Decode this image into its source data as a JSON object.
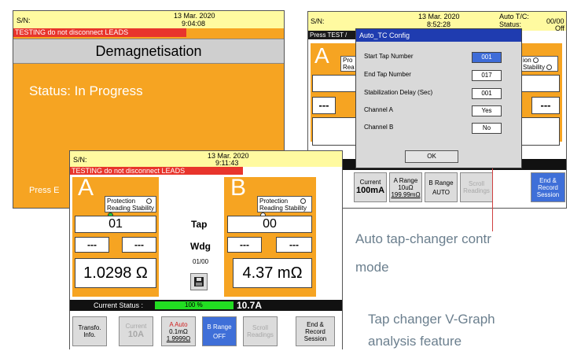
{
  "left_screen": {
    "sn_label": "S/N:",
    "date": "13 Mar. 2020",
    "time": "9:04:08",
    "warning": "TESTING do not disconnect LEADS",
    "title": "Demagnetisation",
    "status": "Status: In Progress",
    "footer_prefix": "Press E"
  },
  "right_screen": {
    "sn_label": "S/N:",
    "date": "13 Mar. 2020",
    "time": "8:52:28",
    "auto_tc_label": "Auto T/C:",
    "status_label": "Status:",
    "counter": "00/00",
    "off_label": "Off",
    "press_text": "Press TEST /",
    "channel_letter": "A",
    "protection_partial": "Pro",
    "reading_partial": "Rea",
    "protection_right": "ion",
    "stability_right": "Stability",
    "dash_left": "---",
    "dash_right": "---",
    "current_partial": "urrent",
    "buttons": {
      "info_partial": "o.",
      "current_label": "Current",
      "current_value": "100mA",
      "arange_label": "A Range",
      "arange_value": "10uΩ",
      "arange_sub": "199.99mΩ",
      "brange_label": "B Range",
      "brange_value": "AUTO",
      "scroll_1": "Scroll",
      "scroll_2": "Readings",
      "end_1": "End &",
      "end_2": "Record",
      "end_3": "Session"
    }
  },
  "dialog": {
    "title": "Auto_TC Config",
    "fields": [
      {
        "label": "Start Tap Number",
        "value": "001"
      },
      {
        "label": "End Tap Number",
        "value": "017"
      },
      {
        "label": "Stabilization Delay (Sec)",
        "value": "001"
      },
      {
        "label": "Channel A",
        "value": "Yes"
      },
      {
        "label": "Channel B",
        "value": "No"
      }
    ],
    "ok_label": "OK"
  },
  "front_screen": {
    "sn_label": "S/N:",
    "date": "13 Mar. 2020",
    "time": "9:11:43",
    "warning": "TESTING do not disconnect LEADS",
    "channel_a": {
      "letter": "A",
      "protection": "Protection",
      "reading_stability": "Reading Stability",
      "tap": "01",
      "dash_left": "---",
      "dash_right": "---",
      "reading": "1.0298 Ω"
    },
    "channel_b": {
      "letter": "B",
      "protection": "Protection",
      "reading_stability": "Reading Stability",
      "tap": "00",
      "dash_left": "---",
      "dash_right": "---",
      "reading": "4.37 mΩ"
    },
    "center": {
      "tap_label": "Tap",
      "wdg_label": "Wdg",
      "counter": "01/00"
    },
    "current_status_label": "Current Status :",
    "progress_percent": 100,
    "progress_label": "100 %",
    "current_value": "10.7A",
    "buttons": {
      "transfo_1": "Transfo.",
      "transfo_2": "Info.",
      "current_label": "Current",
      "current_value": "10A",
      "arange_label": "A  Auto",
      "arange_value": "0.1mΩ",
      "arange_sub": "1.9999Ω",
      "brange_label": "B Range",
      "brange_value": "OFF",
      "scroll_1": "Scroll",
      "scroll_2": "Readings",
      "end_1": "End &",
      "end_2": "Record",
      "end_3": "Session"
    }
  },
  "captions": {
    "auto_tap_line1": "Auto tap-changer contr",
    "auto_tap_line2": "mode",
    "vgraph_line1": "Tap changer V-Graph",
    "vgraph_line2": "analysis feature"
  },
  "colors": {
    "orange": "#f6a422",
    "warning_red": "#e8352c",
    "header_yellow": "#fffaa0",
    "selected_blue": "#3e6cd8",
    "progress_green": "#22dd22",
    "caption_grey": "#6b7f8e"
  }
}
